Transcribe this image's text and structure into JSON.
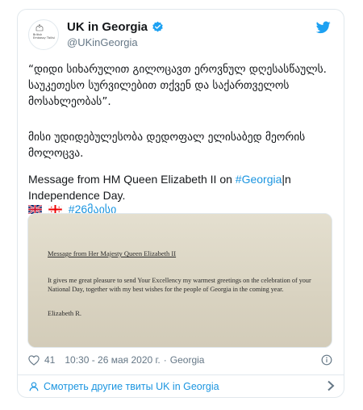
{
  "tweet": {
    "display_name": "UK in Georgia",
    "handle": "@UKinGeorgia",
    "avatar_text": "British Embassy Tbilisi",
    "verified_icon": "verified-badge-icon",
    "platform_icon": "twitter-bird-icon",
    "paragraph_1": "“დიდი სიხარულით გილოცავთ ეროვნულ დღესასწაულს. საუკეთესო სურვილებით  თქვენ და საქართველოს მოსახლეობას”.",
    "paragraph_2": "მისი უდიდებულესობა დედოფალ ელისაბედ მეორის მოლოცვა.",
    "message_prefix": "Message from HM Queen Elizabeth II on ",
    "message_hashtag": "#Georgia",
    "message_suffix": "|n Independence Day.",
    "hashtag_2": "#26მაისი",
    "likes": "41",
    "timestamp": "10:30 - 26 мая 2020 г.",
    "location": "Georgia",
    "more_tweets_label": "Смотреть другие твиты UK in Georgia"
  },
  "media": {
    "letter_heading": "Message from Her Majesty Queen Elizabeth II",
    "letter_body": "It gives me great pleasure to send Your Excellency my warmest greetings on the celebration of your National Day, together with my best wishes for the people of Georgia in the coming year.",
    "letter_signature": "Elizabeth R."
  },
  "colors": {
    "link": "#1b95e0",
    "text": "#14171a",
    "secondary": "#657786",
    "border": "#e1e8ed"
  }
}
